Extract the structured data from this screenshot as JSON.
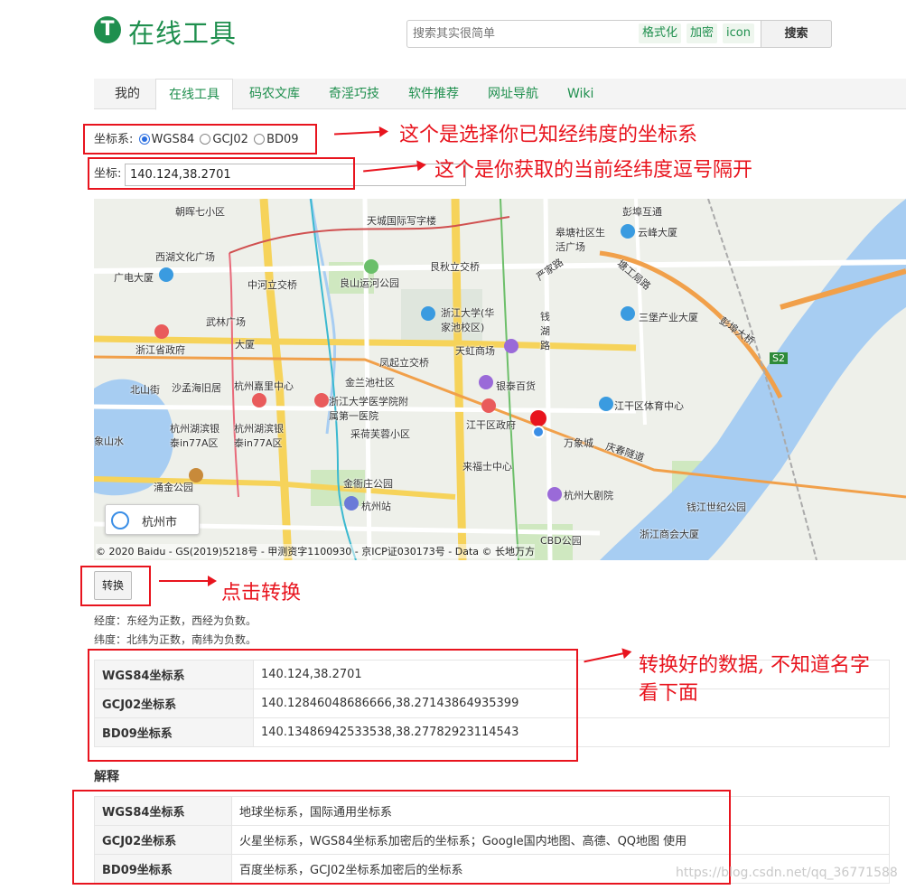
{
  "header": {
    "logo_letter": "T",
    "site_name": "在线工具",
    "search": {
      "placeholder": "搜索其实很简单",
      "tags": [
        "格式化",
        "加密",
        "icon"
      ],
      "button_label": "搜索"
    }
  },
  "nav": {
    "tabs": [
      "我的",
      "在线工具",
      "码农文库",
      "奇淫巧技",
      "软件推荐",
      "网址导航",
      "Wiki"
    ],
    "active": "在线工具"
  },
  "coord_type": {
    "label": "坐标系:",
    "options": [
      "WGS84",
      "GCJ02",
      "BD09"
    ],
    "selected": "WGS84"
  },
  "coord_input": {
    "label": "坐标:",
    "value": "140.124,38.2701"
  },
  "map": {
    "city_button_label": "杭州市",
    "copyright": "© 2020 Baidu - GS(2019)5218号 - 甲测资字1100930 - 京ICP证030173号 - Data © 长地万方",
    "labels": [
      "朝晖七小区",
      "天城国际写字楼",
      "彭埠互通",
      "皋塘社区生活广场",
      "云峰大厦",
      "西湖文化广场",
      "广电大厦",
      "中河立交桥",
      "良山运河公园",
      "艮秋立交桥",
      "严家路",
      "塘工局路",
      "浙江大学(华家池校区)",
      "钱湖路",
      "三堡产业大厦",
      "彭埠大桥",
      "武林广场",
      "浙江省政府",
      "大厦",
      "天虹商场",
      "凤起立交桥",
      "北山街",
      "沙孟海旧居",
      "杭州嘉里中心",
      "金兰池社区",
      "银泰百货",
      "浙江大学医学院附属第一医院",
      "江干区体育中心",
      "江干区政府",
      "杭州湖滨银泰in77A区",
      "杭州湖滨银泰in77A区",
      "采荷芙蓉小区",
      "万象城",
      "庆春隧道",
      "来福士中心",
      "涌金公园",
      "金衙庄公园",
      "杭州大剧院",
      "钱江世纪公园",
      "杭州站",
      "浙江商会大厦",
      "CBD公园",
      "象山水",
      "S2"
    ],
    "selected_point": "140.124,38.2701"
  },
  "convert_button_label": "转换",
  "hints": [
    "经度：东经为正数，西经为负数。",
    "纬度：北纬为正数，南纬为负数。"
  ],
  "results": [
    {
      "name": "WGS84坐标系",
      "value": "140.124,38.2701"
    },
    {
      "name": "GCJ02坐标系",
      "value": "140.12846048686666,38.27143864935399"
    },
    {
      "name": "BD09坐标系",
      "value": "140.13486942533538,38.27782923114543"
    }
  ],
  "explain": {
    "title": "解释",
    "rows": [
      {
        "name": "WGS84坐标系",
        "desc": "地球坐标系，国际通用坐标系"
      },
      {
        "name": "GCJ02坐标系",
        "desc": "火星坐标系，WGS84坐标系加密后的坐标系；Google国内地图、高德、QQ地图 使用"
      },
      {
        "name": "BD09坐标系",
        "desc": "百度坐标系，GCJ02坐标系加密后的坐标系"
      }
    ]
  },
  "annotations": {
    "coord_type_note": "这个是选择你已知经纬度的坐标系",
    "coord_input_note": "这个是你获取的当前经纬度逗号隔开",
    "convert_note": "点击转换",
    "result_note_line1": "转换好的数据, 不知道名字",
    "result_note_line2": "看下面"
  },
  "watermark": "https://blog.csdn.net/qq_36771588",
  "colors": {
    "brand_green": "#1f8f4e",
    "annotation_red": "#e8141e",
    "map_water": "#a7cdf2"
  }
}
